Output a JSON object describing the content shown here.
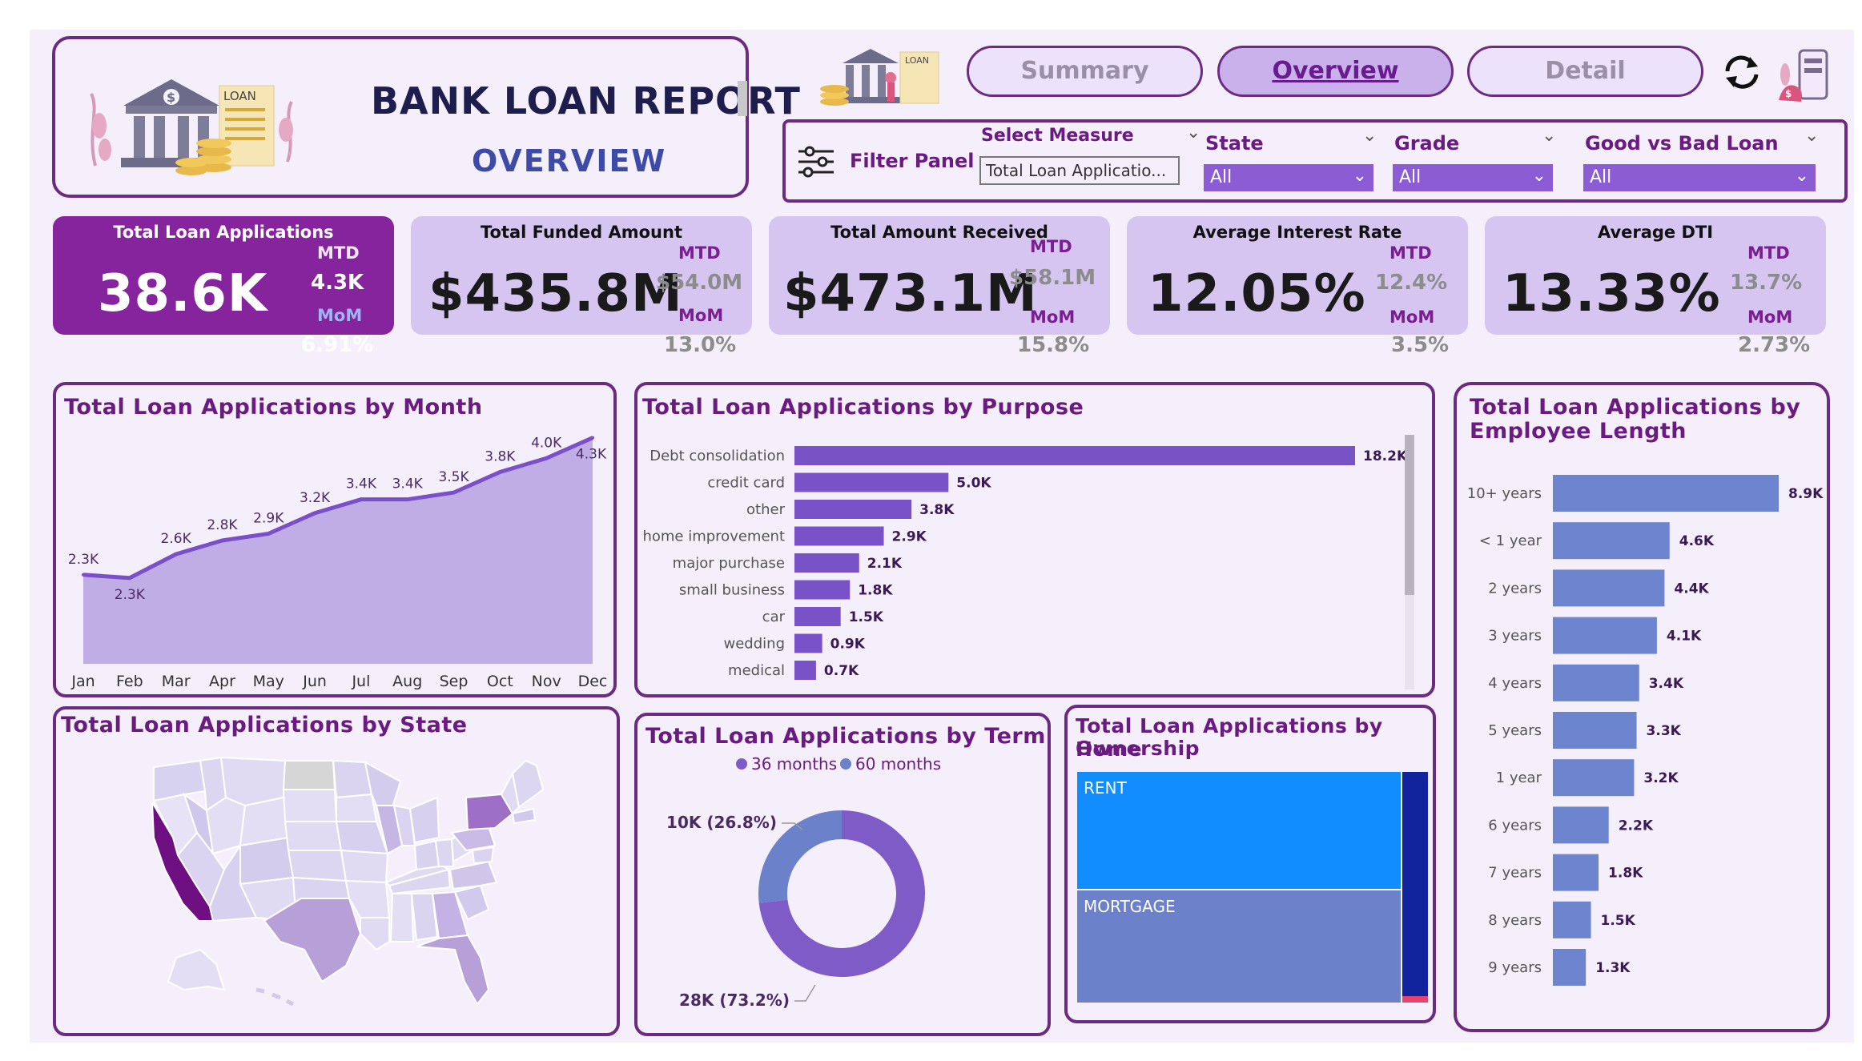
{
  "header": {
    "title": "BANK LOAN REPORT",
    "subtitle": "OVERVIEW",
    "logo_icon": "bank-loan-icon"
  },
  "nav": {
    "tabs": [
      {
        "label": "Summary",
        "active": false
      },
      {
        "label": "Overview",
        "active": true
      },
      {
        "label": "Detail",
        "active": false
      }
    ],
    "refresh_icon": "refresh-icon"
  },
  "filter_panel": {
    "label": "Filter Panel",
    "icon": "sliders-icon",
    "measure": {
      "label": "Select Measure",
      "value": "Total Loan Applicatio..."
    },
    "state": {
      "label": "State",
      "value": "All"
    },
    "grade": {
      "label": "Grade",
      "value": "All"
    },
    "good_bad": {
      "label": "Good vs Bad Loan",
      "value": "All"
    }
  },
  "kpis": [
    {
      "label": "Total Loan Applications",
      "value": "38.6K",
      "mtd_label": "MTD",
      "mtd": "4.3K",
      "mom_label": "MoM",
      "mom": "6.91%"
    },
    {
      "label": "Total Funded Amount",
      "value": "$435.8M",
      "mtd_label": "MTD",
      "mtd": "$54.0M",
      "mom_label": "MoM",
      "mom": "13.0%"
    },
    {
      "label": "Total Amount Received",
      "value": "$473.1M",
      "mtd_label": "MTD",
      "mtd": "$58.1M",
      "mom_label": "MoM",
      "mom": "15.8%"
    },
    {
      "label": "Average Interest Rate",
      "value": "12.05%",
      "mtd_label": "MTD",
      "mtd": "12.4%",
      "mom_label": "MoM",
      "mom": "3.5%"
    },
    {
      "label": "Average DTI",
      "value": "13.33%",
      "mtd_label": "MTD",
      "mtd": "13.7%",
      "mom_label": "MoM",
      "mom": "2.73%"
    }
  ],
  "colors": {
    "purple": "#6b2b80",
    "bar": "#7a52c7",
    "emp_bar": "#6d84cf",
    "area": "#c1ade6",
    "line": "#7a4fc7",
    "rent": "#118dff",
    "mortgage": "#6b81c9",
    "other": "#12239e"
  },
  "charts": {
    "month": {
      "title": "Total Loan Applications by Month"
    },
    "purpose": {
      "title": "Total Loan Applications by Purpose"
    },
    "employee": {
      "title_line1": "Total Loan Applications by",
      "title_line2": "Employee Length"
    },
    "state": {
      "title": "Total Loan Applications by State"
    },
    "term": {
      "title": "Total Loan Applications by Term"
    },
    "home": {
      "title_line1": "Total Loan Applications by Home",
      "title_line2": "Ownership"
    }
  },
  "chart_data": [
    {
      "id": "month",
      "type": "area",
      "title": "Total Loan Applications by Month",
      "categories": [
        "Jan",
        "Feb",
        "Mar",
        "Apr",
        "May",
        "Jun",
        "Jul",
        "Aug",
        "Sep",
        "Oct",
        "Nov",
        "Dec"
      ],
      "values": [
        2.3,
        2.3,
        2.6,
        2.8,
        2.9,
        3.2,
        3.4,
        3.4,
        3.5,
        3.8,
        4.0,
        4.3
      ],
      "labels": [
        "2.3K",
        "2.3K",
        "2.6K",
        "2.8K",
        "2.9K",
        "3.2K",
        "3.4K",
        "3.4K",
        "3.5K",
        "3.8K",
        "4.0K",
        "4.3K"
      ]
    },
    {
      "id": "purpose",
      "type": "bar",
      "title": "Total Loan Applications by Purpose",
      "categories": [
        "Debt consolidation",
        "credit card",
        "other",
        "home improvement",
        "major purchase",
        "small business",
        "car",
        "wedding",
        "medical"
      ],
      "values": [
        18.2,
        5.0,
        3.8,
        2.9,
        2.1,
        1.8,
        1.5,
        0.9,
        0.7
      ],
      "labels": [
        "18.2K",
        "5.0K",
        "3.8K",
        "2.9K",
        "2.1K",
        "1.8K",
        "1.5K",
        "0.9K",
        "0.7K"
      ]
    },
    {
      "id": "employee",
      "type": "bar",
      "title": "Total Loan Applications by Employee Length",
      "categories": [
        "10+ years",
        "< 1 year",
        "2 years",
        "3 years",
        "4 years",
        "5 years",
        "1 year",
        "6 years",
        "7 years",
        "8 years",
        "9 years"
      ],
      "values": [
        8.9,
        4.6,
        4.4,
        4.1,
        3.4,
        3.3,
        3.2,
        2.2,
        1.8,
        1.5,
        1.3
      ],
      "labels": [
        "8.9K",
        "4.6K",
        "4.4K",
        "4.1K",
        "3.4K",
        "3.3K",
        "3.2K",
        "2.2K",
        "1.8K",
        "1.5K",
        "1.3K"
      ]
    },
    {
      "id": "term",
      "type": "pie",
      "title": "Total Loan Applications by Term",
      "series": [
        {
          "name": "36 months",
          "value": 28,
          "pct": 73.2,
          "label": "28K (73.2%)",
          "color": "#7f5bc8"
        },
        {
          "name": "60 months",
          "value": 10,
          "pct": 26.8,
          "label": "10K (26.8%)",
          "color": "#6b81c9"
        }
      ]
    },
    {
      "id": "home",
      "type": "treemap",
      "title": "Total Loan Applications by Home Ownership",
      "categories": [
        "RENT",
        "MORTGAGE"
      ]
    }
  ]
}
